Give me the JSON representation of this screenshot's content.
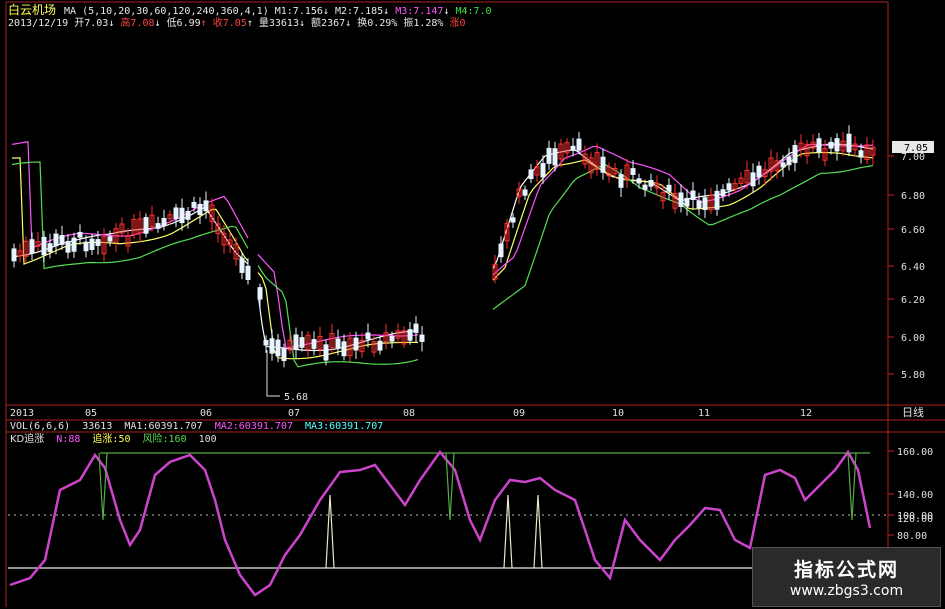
{
  "stock": {
    "name": "白云机场",
    "ma_label": "MA (5,10,20,30,60,120,240,360,4,1)",
    "m1": "M1:7.156",
    "m2": "M2:7.185",
    "m3": "M3:7.147",
    "m4": "M4:7.0"
  },
  "quote": {
    "date": "2013/12/19",
    "open": "开7.03",
    "high": "高7.08",
    "low": "低6.99",
    "close": "收7.05",
    "volume": "量33613",
    "amount": "额2367",
    "turnover": "换0.29%",
    "amplitude": "振1.28%",
    "change": "涨0"
  },
  "colors": {
    "up": "#ff3030",
    "down": "#ffffff",
    "bg": "#000000",
    "axis": "#cc2222",
    "kd": "#cc44cc",
    "signal": "#66aa44",
    "vol_text": "#55ffff"
  },
  "main_panel": {
    "price_ticks": [
      "7.00",
      "6.80",
      "6.60",
      "6.40",
      "6.20",
      "6.00",
      "5.80"
    ],
    "last_price": "7.05",
    "low_annotation": "5.68",
    "months": [
      "2013",
      "05",
      "06",
      "07",
      "08",
      "09",
      "10",
      "11",
      "12"
    ],
    "period_label": "日线"
  },
  "vol_panel": {
    "label": "VOL(6,6,6)",
    "value": "33613",
    "ma1": "MA1:60391.707",
    "ma2": "MA2:60391.707",
    "ma3": "MA3:60391.707"
  },
  "kd_panel": {
    "label": "KD追涨",
    "n": "N:88",
    "chase": "追涨:50",
    "risk": "风险:160",
    "extra": "100",
    "ticks": [
      "160.00",
      "140.00",
      "120.00",
      "100.00",
      "80.00"
    ]
  },
  "watermark": {
    "line1": "指标公式网",
    "line2": "www.zbgs3.com"
  }
}
